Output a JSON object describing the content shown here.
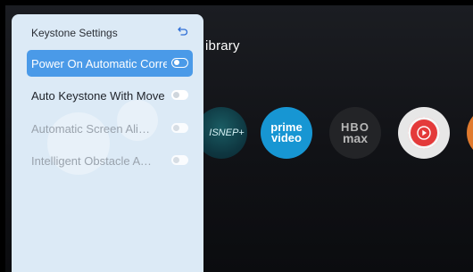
{
  "background": {
    "heading_fragment": "ibrary",
    "apps": [
      {
        "name": "disney-plus",
        "text": "ISNEP+"
      },
      {
        "name": "prime-video",
        "line1": "prime",
        "line2": "video"
      },
      {
        "name": "hbo-max",
        "line1": "HBO",
        "line2": "max"
      },
      {
        "name": "youtube",
        "icon": "play-icon"
      },
      {
        "name": "partial-app"
      }
    ]
  },
  "panel": {
    "title": "Keystone Settings",
    "back_icon": "back-arrow-icon",
    "items": [
      {
        "label": "Power On Automatic Correction",
        "state": "on",
        "focused": true,
        "disabled": false
      },
      {
        "label": "Auto Keystone With Move",
        "state": "off",
        "focused": false,
        "disabled": false
      },
      {
        "label": "Automatic Screen Alignment",
        "state": "off",
        "focused": false,
        "disabled": true
      },
      {
        "label": "Intelligent Obstacle Avoidance",
        "state": "off",
        "focused": false,
        "disabled": true
      }
    ]
  },
  "colors": {
    "panel_bg": "#dceaf6",
    "focus_accent": "#4a9ae8",
    "prime_blue": "#1796d3",
    "youtube_red": "#e43a3a"
  }
}
